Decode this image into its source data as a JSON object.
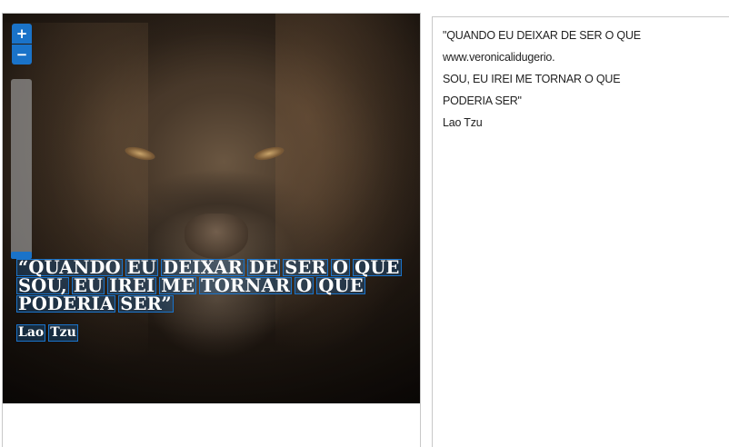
{
  "viewer": {
    "zoom_in_label": "+",
    "zoom_out_label": "−",
    "zoom_level": 1.0,
    "image_alt": "Lion face photo with quote",
    "overlay_lines": [
      [
        "“QUANDO",
        "EU",
        "DEIXAR",
        "DE",
        "SER",
        "O",
        "QUE"
      ],
      [
        "SOU,",
        "EU",
        "IREI",
        "ME",
        "TORNAR",
        "O",
        "QUE"
      ],
      [
        "PODERIA",
        "SER”"
      ]
    ],
    "author_words": [
      "Lao",
      "Tzu"
    ]
  },
  "ocr": {
    "lines": [
      "\"QUANDO EU DEIXAR DE SER O QUE",
      "www.veronicalidugerio.",
      "SOU, EU IREI ME TORNAR O QUE",
      "PODERIA SER\"",
      "Lao Tzu"
    ]
  },
  "colors": {
    "accent": "#1a73c9",
    "panel_border": "#c8c8c8"
  }
}
